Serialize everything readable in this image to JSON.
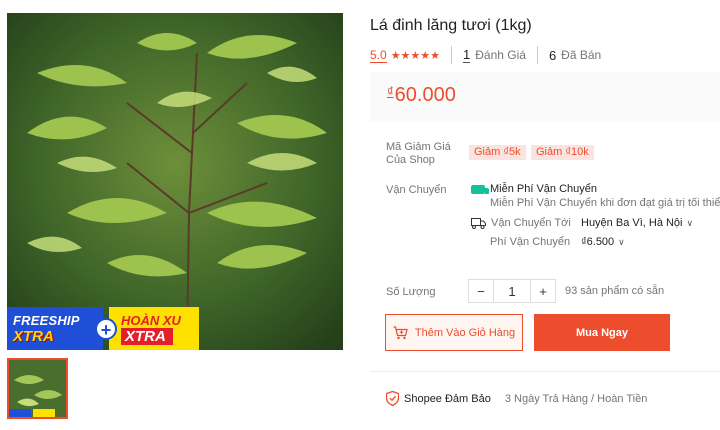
{
  "product": {
    "title": "Lá đinh lăng tươi (1kg)",
    "rating": "5.0",
    "stars": "★★★★★",
    "review_count": "1",
    "review_label": "Đánh Giá",
    "sold_count": "6",
    "sold_label": "Đã Bán",
    "currency": "₫",
    "price": "60.000"
  },
  "promo": {
    "freeship_line1": "FREESHIP",
    "freeship_line2": "XTRA",
    "plus": "+",
    "hoanxu_line1": "HOÀN XU",
    "hoanxu_line2": "XTRA"
  },
  "vouchers": {
    "label": "Mã Giảm Giá Của Shop",
    "items": [
      "Giảm ₫5k",
      "Giảm ₫10k"
    ]
  },
  "shipping": {
    "label": "Vận Chuyển",
    "free_title": "Miễn Phí Vận Chuyển",
    "free_note": "Miễn Phí Vận Chuyển khi đơn đạt giá trị tối thiểu",
    "ship_to_label": "Vận Chuyển Tới",
    "destination": "Huyện Ba Vì, Hà Nội",
    "fee_label": "Phí Vận Chuyển",
    "fee": "₫6.500"
  },
  "quantity": {
    "label": "Số Lượng",
    "minus": "−",
    "value": "1",
    "plus": "+",
    "stock": "93 sản phẩm có sẵn"
  },
  "actions": {
    "add_to_cart": "Thêm Vào Giỏ Hàng",
    "buy_now": "Mua Ngay"
  },
  "guarantee": {
    "label": "Shopee Đảm Bảo",
    "text": "3 Ngày Trả Hàng / Hoàn Tiền"
  },
  "colors": {
    "accent": "#ee4d2d",
    "free_ship": "#13c29c",
    "freeship_blue": "#1e4fd6",
    "hoanxu_yellow": "#ffe100"
  },
  "icons": {
    "star": "star-icon",
    "truck": "truck-icon",
    "cart": "cart-plus-icon",
    "shield": "shield-icon"
  }
}
